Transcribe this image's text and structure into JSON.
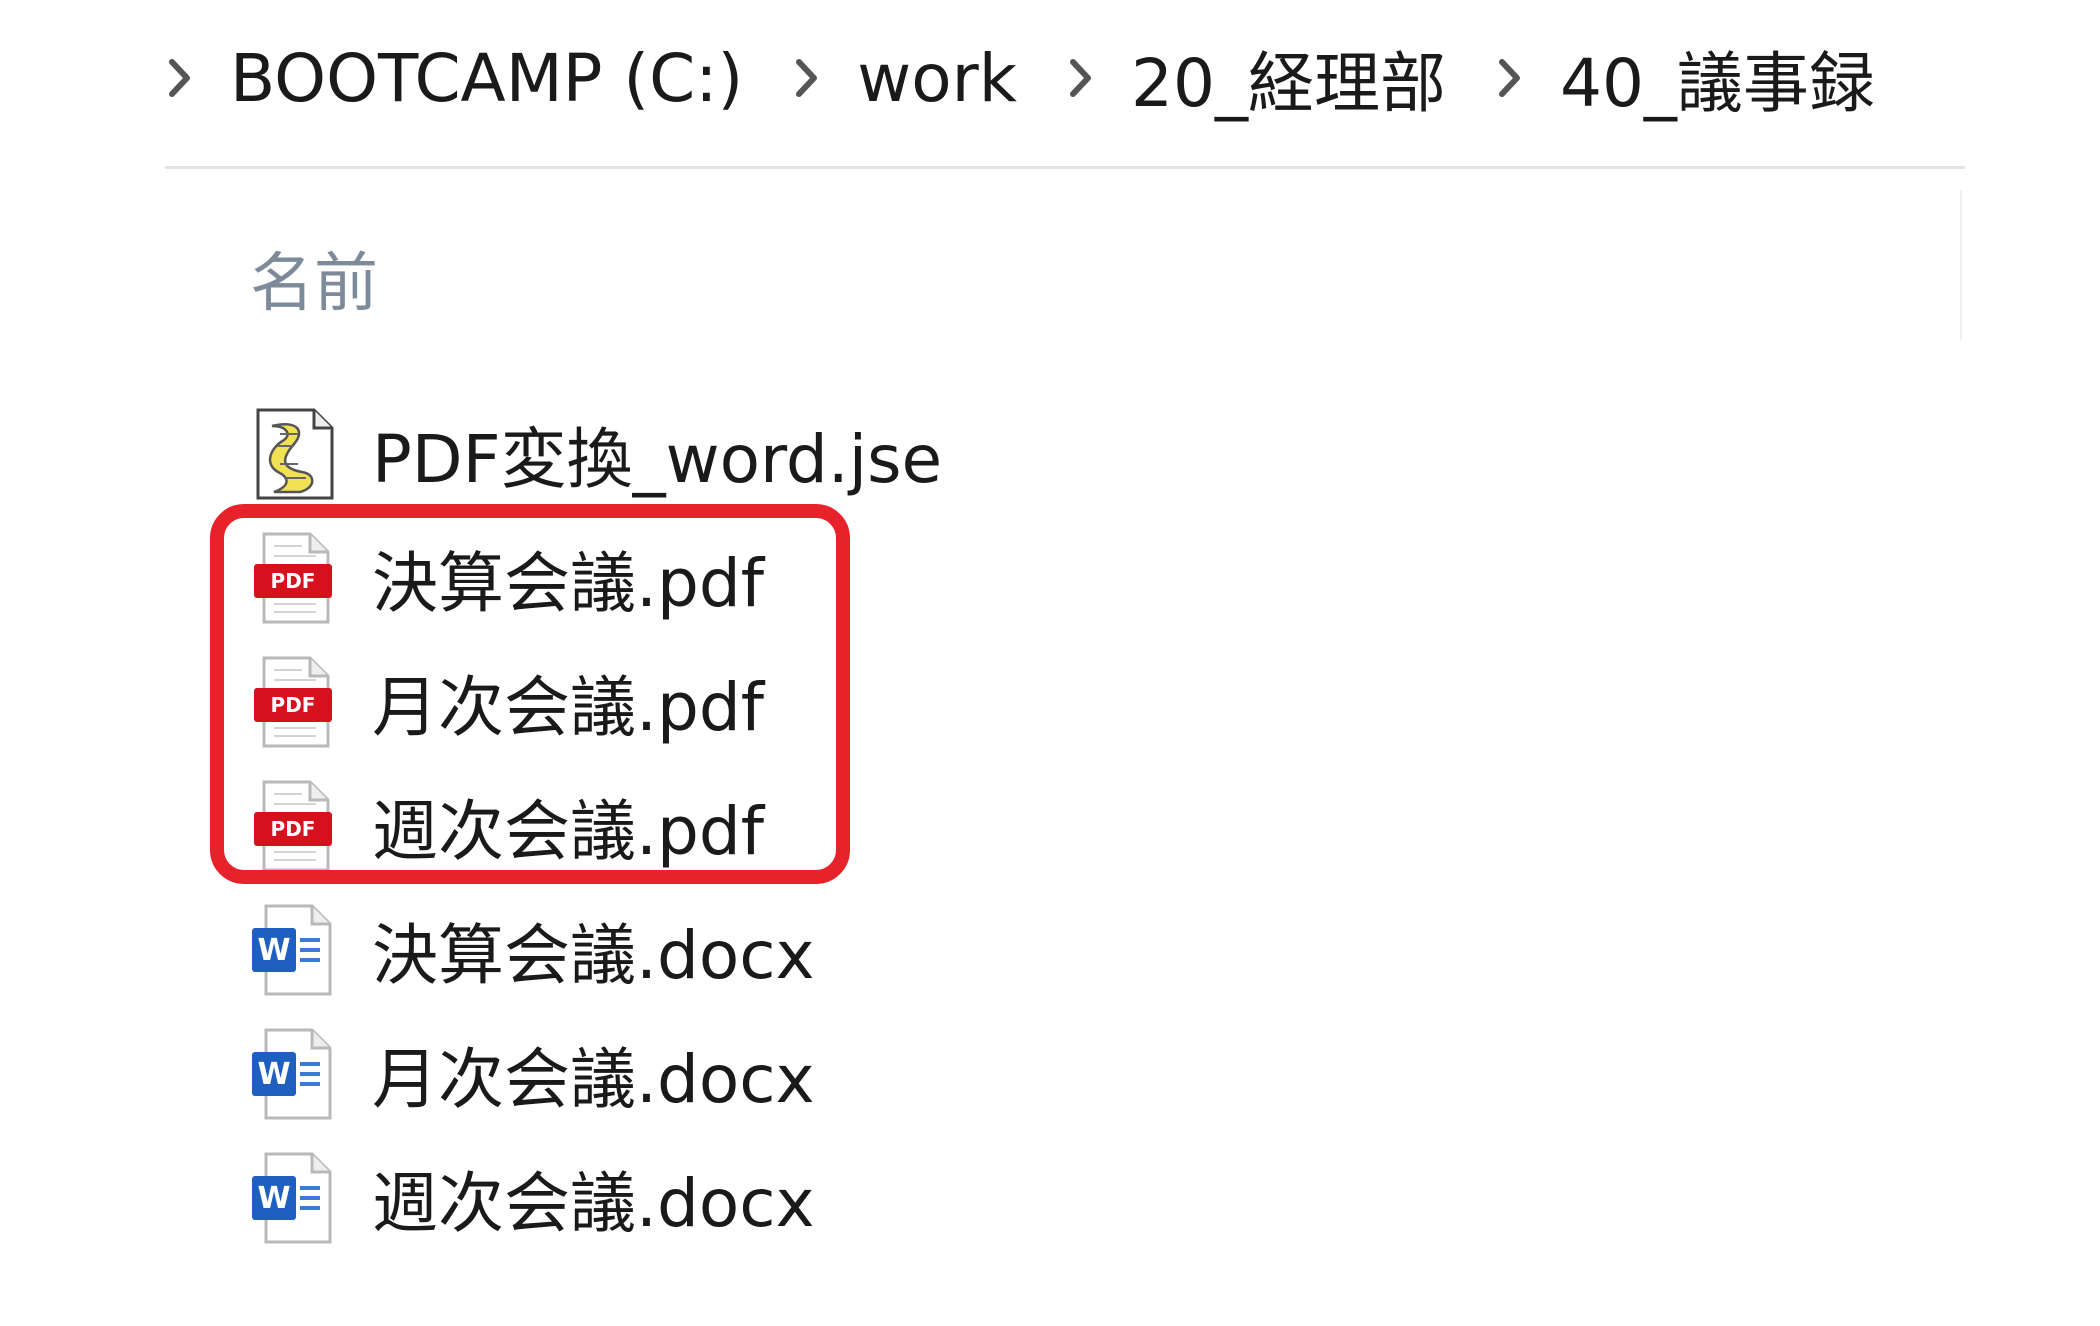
{
  "breadcrumb": {
    "items": [
      {
        "label": "BOOTCAMP (C:)"
      },
      {
        "label": "work"
      },
      {
        "label": "20_経理部"
      },
      {
        "label": "40_議事録"
      }
    ]
  },
  "list": {
    "column_name_label": "名前"
  },
  "files": [
    {
      "name": "PDF変換_word.jse",
      "icon": "script-file-icon"
    },
    {
      "name": "決算会議.pdf",
      "icon": "pdf-file-icon"
    },
    {
      "name": "月次会議.pdf",
      "icon": "pdf-file-icon"
    },
    {
      "name": "週次会議.pdf",
      "icon": "pdf-file-icon"
    },
    {
      "name": "決算会議.docx",
      "icon": "word-file-icon"
    },
    {
      "name": "月次会議.docx",
      "icon": "word-file-icon"
    },
    {
      "name": "週次会議.docx",
      "icon": "word-file-icon"
    }
  ],
  "icons": {
    "pdf_badge_text": "PDF",
    "word_badge_text": "W"
  },
  "colors": {
    "highlight": "#e8222b",
    "pdf_red": "#d6111d",
    "word_blue": "#1f5fbf",
    "header_text": "#7d8a99"
  }
}
